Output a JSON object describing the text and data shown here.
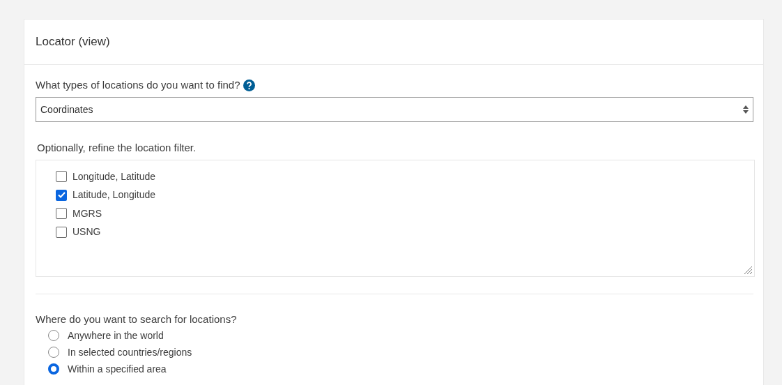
{
  "panel": {
    "title": "Locator (view)"
  },
  "location_types": {
    "label": "What types of locations do you want to find?",
    "select_value": "Coordinates"
  },
  "filter": {
    "label": "Optionally, refine the location filter.",
    "options": [
      {
        "label": "Longitude, Latitude",
        "checked": false
      },
      {
        "label": "Latitude, Longitude",
        "checked": true
      },
      {
        "label": "MGRS",
        "checked": false
      },
      {
        "label": "USNG",
        "checked": false
      }
    ]
  },
  "search_area": {
    "label": "Where do you want to search for locations?",
    "options": [
      {
        "label": "Anywhere in the world",
        "selected": false
      },
      {
        "label": "In selected countries/regions",
        "selected": false
      },
      {
        "label": "Within a specified area",
        "selected": true
      }
    ]
  }
}
